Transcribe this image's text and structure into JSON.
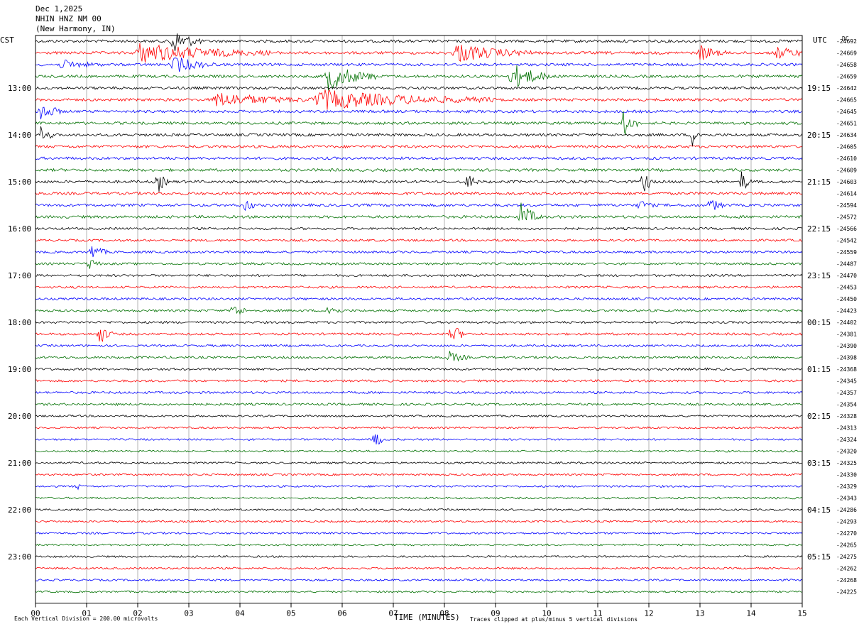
{
  "header": {
    "date": "Dec 1,2025",
    "station": "NHIN HNZ NM 00",
    "location": "(New Harmony, IN)"
  },
  "left_tz": "CST",
  "right_tz": "UTC",
  "dc_label": "DC",
  "footer": {
    "scale_note": "Each Vertical Division =  200.00 microvolts",
    "xlabel": "TIME (MINUTES)",
    "clip_note": "Traces clipped at plus/minus 5 vertical divisions"
  },
  "chart_data": {
    "type": "line",
    "title": "NHIN HNZ NM 00 (New Harmony, IN) Dec 1,2025",
    "xlabel": "TIME (MINUTES)",
    "x_range": [
      0,
      15
    ],
    "x_ticks": [
      "00",
      "01",
      "02",
      "03",
      "04",
      "05",
      "06",
      "07",
      "08",
      "09",
      "10",
      "11",
      "12",
      "13",
      "14",
      "15"
    ],
    "trace_colors": [
      "#000000",
      "#ff0000",
      "#0000ff",
      "#007000"
    ],
    "trace_minutes": 15,
    "trace_count": 48,
    "left_hour_labels": [
      "13:00",
      "14:00",
      "15:00",
      "16:00",
      "17:00",
      "18:00",
      "19:00",
      "20:00",
      "21:00",
      "22:00",
      "23:00"
    ],
    "right_hour_labels": [
      "19:15",
      "20:15",
      "21:15",
      "22:15",
      "23:15",
      "00:15",
      "01:15",
      "02:15",
      "03:15",
      "04:15",
      "05:15"
    ],
    "dc_offsets": [
      "-24692",
      "-24669",
      "-24658",
      "-24659",
      "-24642",
      "-24665",
      "-24645",
      "-24651",
      "-24634",
      "-24605",
      "-24610",
      "-24609",
      "-24603",
      "-24614",
      "-24594",
      "-24572",
      "-24566",
      "-24542",
      "-24559",
      "-24487",
      "-24470",
      "-24453",
      "-24450",
      "-24423",
      "-24402",
      "-24381",
      "-24390",
      "-24398",
      "-24368",
      "-24345",
      "-24357",
      "-24354",
      "-24328",
      "-24313",
      "-24324",
      "-24320",
      "-24325",
      "-24330",
      "-24329",
      "-24343",
      "-24286",
      "-24293",
      "-24270",
      "-24265",
      "-24275",
      "-24262",
      "-24268",
      "-24225"
    ],
    "events": [
      {
        "trace": 0,
        "minute": 2.65,
        "amplitude": 5,
        "duration_min": 0.6
      },
      {
        "trace": 1,
        "minute": 2.0,
        "amplitude": 3.5,
        "duration_min": 2.6
      },
      {
        "trace": 1,
        "minute": 8.2,
        "amplitude": 3.5,
        "duration_min": 1.5
      },
      {
        "trace": 1,
        "minute": 13.0,
        "amplitude": 3,
        "duration_min": 0.5
      },
      {
        "trace": 1,
        "minute": 14.5,
        "amplitude": 2,
        "duration_min": 0.8
      },
      {
        "trace": 2,
        "minute": 2.7,
        "amplitude": 3,
        "duration_min": 0.8
      },
      {
        "trace": 2,
        "minute": 0.5,
        "amplitude": 1.5,
        "duration_min": 0.8
      },
      {
        "trace": 3,
        "minute": 5.7,
        "amplitude": 5,
        "duration_min": 1.0
      },
      {
        "trace": 3,
        "minute": 9.3,
        "amplitude": 5,
        "duration_min": 0.8
      },
      {
        "trace": 5,
        "minute": 5.5,
        "amplitude": 3.5,
        "duration_min": 3.5
      },
      {
        "trace": 5,
        "minute": 3.5,
        "amplitude": 2.5,
        "duration_min": 2.0
      },
      {
        "trace": 6,
        "minute": 0.1,
        "amplitude": 4,
        "duration_min": 0.4
      },
      {
        "trace": 7,
        "minute": 11.5,
        "amplitude": 5,
        "duration_min": 0.3
      },
      {
        "trace": 8,
        "minute": 0.1,
        "amplitude": 3,
        "duration_min": 0.3
      },
      {
        "trace": 8,
        "minute": 12.85,
        "amplitude": 4,
        "duration_min": 0.2
      },
      {
        "trace": 12,
        "minute": 2.4,
        "amplitude": 4,
        "duration_min": 0.2
      },
      {
        "trace": 12,
        "minute": 8.45,
        "amplitude": 4,
        "duration_min": 0.2
      },
      {
        "trace": 12,
        "minute": 11.9,
        "amplitude": 5,
        "duration_min": 0.2
      },
      {
        "trace": 12,
        "minute": 13.8,
        "amplitude": 5,
        "duration_min": 0.2
      },
      {
        "trace": 14,
        "minute": 4.1,
        "amplitude": 3,
        "duration_min": 0.2
      },
      {
        "trace": 14,
        "minute": 13.2,
        "amplitude": 2.5,
        "duration_min": 0.3
      },
      {
        "trace": 14,
        "minute": 11.8,
        "amplitude": 2,
        "duration_min": 0.3
      },
      {
        "trace": 15,
        "minute": 9.5,
        "amplitude": 5,
        "duration_min": 0.4
      },
      {
        "trace": 18,
        "minute": 1.1,
        "amplitude": 3,
        "duration_min": 0.3
      },
      {
        "trace": 19,
        "minute": 1.05,
        "amplitude": 3,
        "duration_min": 0.2
      },
      {
        "trace": 23,
        "minute": 3.85,
        "amplitude": 3,
        "duration_min": 0.3
      },
      {
        "trace": 23,
        "minute": 5.7,
        "amplitude": 2.5,
        "duration_min": 0.3
      },
      {
        "trace": 25,
        "minute": 1.25,
        "amplitude": 3.5,
        "duration_min": 0.3
      },
      {
        "trace": 25,
        "minute": 8.15,
        "amplitude": 4,
        "duration_min": 0.3
      },
      {
        "trace": 27,
        "minute": 8.1,
        "amplitude": 2,
        "duration_min": 0.4
      },
      {
        "trace": 34,
        "minute": 6.65,
        "amplitude": 5,
        "duration_min": 0.15
      },
      {
        "trace": 38,
        "minute": 0.8,
        "amplitude": 2,
        "duration_min": 0.1
      }
    ]
  }
}
